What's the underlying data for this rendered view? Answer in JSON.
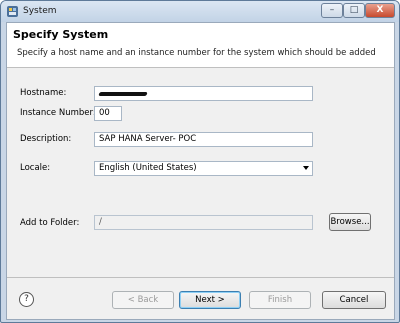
{
  "window": {
    "title": "System"
  },
  "header": {
    "title": "Specify System",
    "description": "Specify a host name and an instance number for the system which should be added"
  },
  "form": {
    "hostname_label": "Hostname:",
    "instance_label": "Instance Number:",
    "instance_value": "00",
    "description_label": "Description:",
    "description_value": "SAP HANA Server- POC",
    "locale_label": "Locale:",
    "locale_value": "English (United States)",
    "folder_label": "Add to Folder:",
    "folder_value": "/",
    "browse_label": "Browse..."
  },
  "footer": {
    "help_glyph": "?",
    "back_label": "< Back",
    "next_label": "Next >",
    "finish_label": "Finish",
    "cancel_label": "Cancel"
  },
  "controls": {
    "minimize": "–",
    "maximize": "□",
    "close": "X"
  }
}
